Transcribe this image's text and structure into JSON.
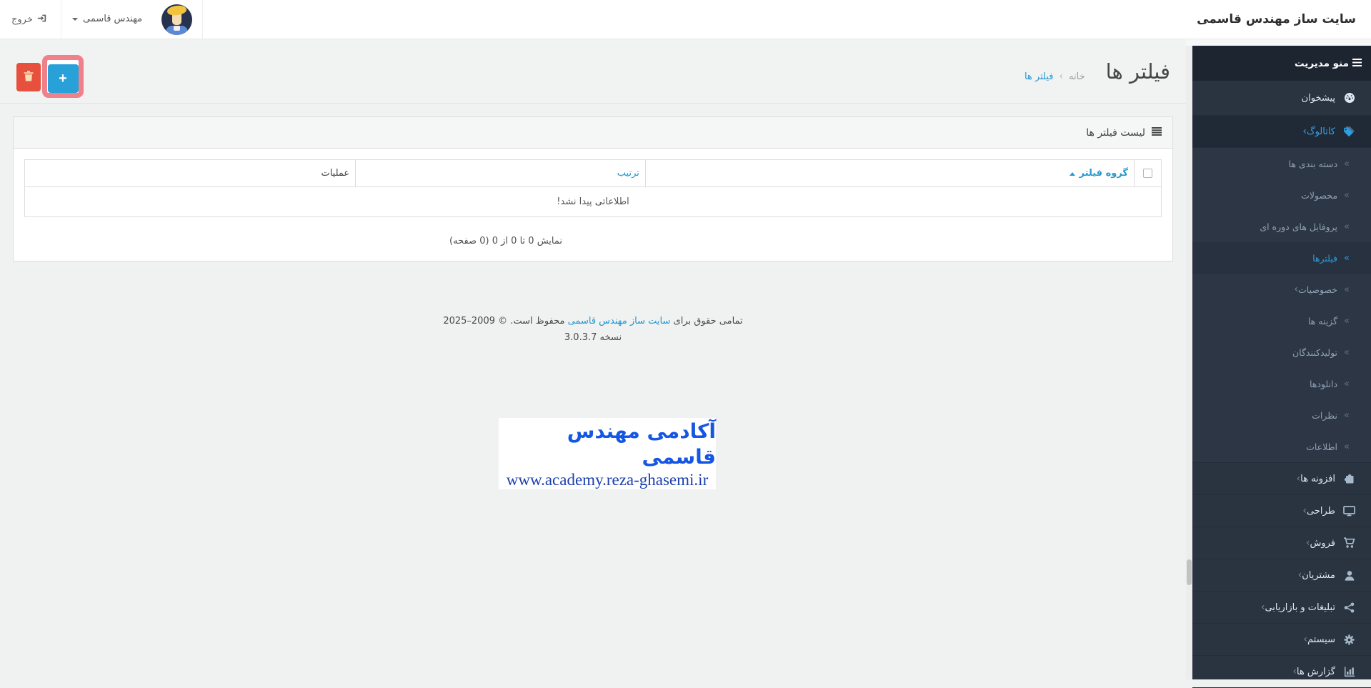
{
  "brand": {
    "title": "سایت ساز مهندس قاسمی"
  },
  "navbar": {
    "logout_label": "خروج",
    "user_name": "مهندس قاسمی"
  },
  "icons": {
    "chevron": "‹",
    "double_angle": "«",
    "breadcrumb_sep": "‹"
  },
  "toolbar": {
    "add_icon": "+"
  },
  "sidebar": {
    "header": "منو مدیریت",
    "top_items": [
      {
        "id": "dashboard",
        "label": "پیشخوان",
        "icon": "dashboard-icon",
        "active": false,
        "has_children": false
      },
      {
        "id": "catalog",
        "label": "کاتالوگ",
        "icon": "tags-icon",
        "active": true,
        "has_children": true
      }
    ],
    "catalog_submenu": [
      {
        "id": "categories",
        "label": "دسته بندی ها"
      },
      {
        "id": "products",
        "label": "محصولات"
      },
      {
        "id": "recurring-profiles",
        "label": "پروفایل های دوره ای"
      },
      {
        "id": "filters",
        "label": "فیلترها",
        "active": true
      },
      {
        "id": "attributes",
        "label": "خصوصیات",
        "has_children": true
      },
      {
        "id": "options",
        "label": "گزینه ها"
      },
      {
        "id": "manufacturers",
        "label": "تولیدکنندگان"
      },
      {
        "id": "downloads",
        "label": "دانلودها"
      },
      {
        "id": "reviews",
        "label": "نظرات"
      },
      {
        "id": "information",
        "label": "اطلاعات"
      }
    ],
    "bottom_items": [
      {
        "id": "extensions",
        "label": "افزونه ها",
        "icon": "puzzle-icon",
        "has_children": true
      },
      {
        "id": "design",
        "label": "طراحی",
        "icon": "monitor-icon",
        "has_children": true
      },
      {
        "id": "sales",
        "label": "فروش",
        "icon": "cart-icon",
        "has_children": true
      },
      {
        "id": "customers",
        "label": "مشتریان",
        "icon": "user-icon",
        "has_children": true
      },
      {
        "id": "marketing",
        "label": "تبلیغات و بازاریابی",
        "icon": "share-icon",
        "has_children": true
      },
      {
        "id": "system",
        "label": "سیستم",
        "icon": "gear-icon",
        "has_children": true
      },
      {
        "id": "reports",
        "label": "گزارش ها",
        "icon": "chart-icon",
        "has_children": true
      }
    ]
  },
  "page": {
    "title": "فیلتر ها",
    "breadcrumb": [
      {
        "label": "خانه"
      },
      {
        "label": "فیلتر ها"
      }
    ]
  },
  "panel": {
    "heading": "لیست فیلتر ها",
    "table": {
      "columns": [
        {
          "id": "filter-group",
          "label": "گروه فیلتر",
          "link": true,
          "sort": "asc"
        },
        {
          "id": "sort-order",
          "label": "ترتیب",
          "link": true
        },
        {
          "id": "action",
          "label": "عملیات",
          "link": false
        }
      ],
      "empty_text": "اطلاعاتی پیدا نشد!",
      "results_text": "نمایش 0 تا 0 از 0 (0 صفحه)"
    }
  },
  "footer": {
    "copyright_prefix": "تمامی حقوق برای",
    "copyright_link": "سایت ساز مهندس قاسمی",
    "copyright_suffix": "محفوظ است. © 2009–2025",
    "version": "نسخه 3.0.3.7"
  },
  "watermark": {
    "title": "آکادمی مهندس قاسمی",
    "url": "www.academy.reza-ghasemi.ir"
  },
  "colors": {
    "accent_blue": "#28a0d8",
    "danger_red": "#e6503c",
    "highlight_pink": "#f0808a",
    "link_blue": "#2599d0",
    "sidebar_bg": "#2a3441",
    "sidebar_active_blue": "#2d9ddd",
    "watermark_blue": "#1556e4",
    "watermark_url_blue": "#1c41ad"
  }
}
